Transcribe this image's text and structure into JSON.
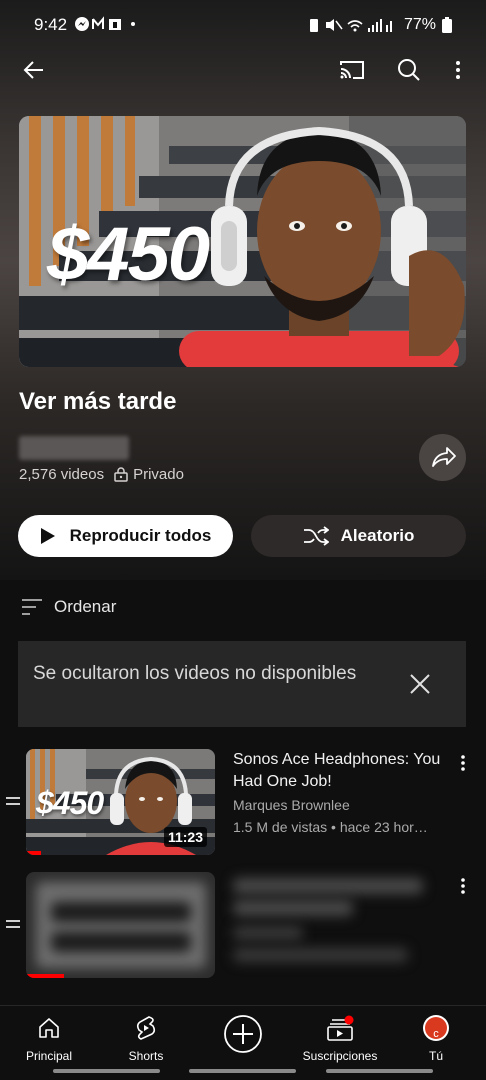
{
  "status_bar": {
    "time": "9:42",
    "left_icons": [
      "messenger-icon",
      "gmail-icon",
      "teams-icon",
      "dot-icon"
    ],
    "right_icons": [
      "battery-saver-icon",
      "mute-icon",
      "wifi-icon",
      "signal-icon"
    ],
    "battery": "77%"
  },
  "topbar": {
    "icons": [
      "back-icon",
      "cast-icon",
      "search-icon",
      "more-vert-icon"
    ]
  },
  "playlist": {
    "title": "Ver más tarde",
    "video_count": "2,576 videos",
    "privacy": "Privado",
    "hero_text": "$450"
  },
  "actions": {
    "play_all": "Reproducir todos",
    "shuffle": "Aleatorio"
  },
  "sort": {
    "label": "Ordenar"
  },
  "notice": {
    "text": "Se ocultaron los videos no disponibles"
  },
  "videos": [
    {
      "title": "Sonos Ace Headphones: You Had One Job!",
      "channel": "Marques Brownlee",
      "meta": "1.5 M de vistas • hace 23 hor…",
      "duration": "11:23",
      "thumb_text": "$450",
      "progress_fraction": 0.08
    },
    {
      "blurred": true,
      "progress_fraction": 0.2
    }
  ],
  "bottom_nav": {
    "items": [
      {
        "label": "Principal",
        "icon": "home-icon"
      },
      {
        "label": "Shorts",
        "icon": "shorts-icon"
      },
      {
        "label": "",
        "icon": "create-icon"
      },
      {
        "label": "Suscripciones",
        "icon": "subscriptions-icon"
      },
      {
        "label": "Tú",
        "icon": "avatar-icon",
        "avatar_letter": "c"
      }
    ]
  },
  "colors": {
    "background": "#0f0f0f",
    "accent_red": "#ff0000",
    "notice_bg": "#272727",
    "shuffle_bg": "#2e2a29"
  }
}
